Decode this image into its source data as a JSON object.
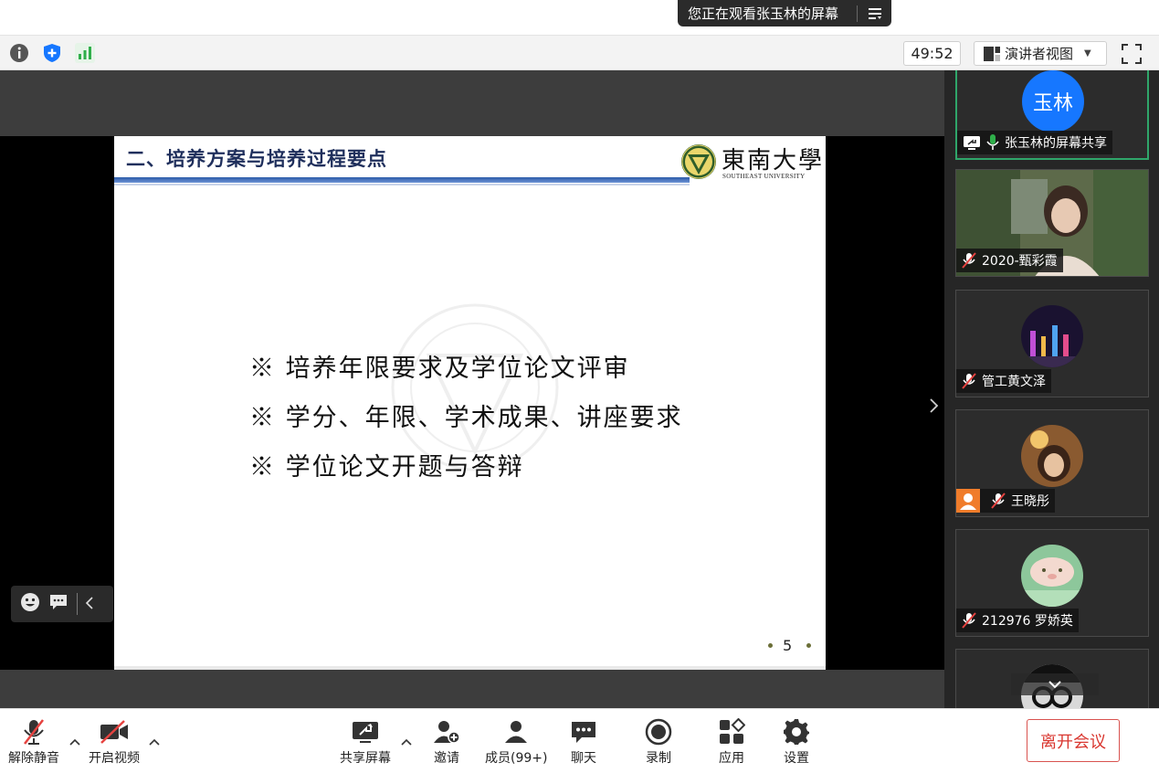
{
  "banner": {
    "sharing_text": "您正在观看张玉林的屏幕"
  },
  "toolbar": {
    "timer": "49:52",
    "view_mode": "演讲者视图"
  },
  "slide": {
    "title": "二、培养方案与培养过程要点",
    "university_cn": "東南大學",
    "university_en": "SOUTHEAST UNIVERSITY",
    "bullets": [
      "※ 培养年限要求及学位论文评审",
      "※ 学分、年限、学术成果、讲座要求",
      "※ 学位论文开题与答辩"
    ],
    "page_number": "5"
  },
  "participants": [
    {
      "name": "张玉林的屏幕共享",
      "avatar_text": "玉林",
      "status": "sharing",
      "mic": "on"
    },
    {
      "name": "2020-甄彩霞",
      "status": "video",
      "mic": "muted"
    },
    {
      "name": "管工黄文泽",
      "status": "avatar",
      "mic": "muted"
    },
    {
      "name": "王晓彤",
      "status": "avatar",
      "mic": "muted"
    },
    {
      "name": "212976 罗娇英",
      "status": "avatar",
      "mic": "muted"
    },
    {
      "name": "",
      "status": "avatar",
      "mic": "muted"
    }
  ],
  "controls": {
    "unmute": "解除静音",
    "start_video": "开启视频",
    "share_screen": "共享屏幕",
    "invite": "邀请",
    "members": "成员(99+)",
    "chat": "聊天",
    "record": "录制",
    "apps": "应用",
    "settings": "设置",
    "leave": "离开会议"
  },
  "colors": {
    "accent_blue": "#1677ff",
    "signal_green": "#2fae4a",
    "leave_red": "#d9362f",
    "active_border": "#2fa66a"
  }
}
